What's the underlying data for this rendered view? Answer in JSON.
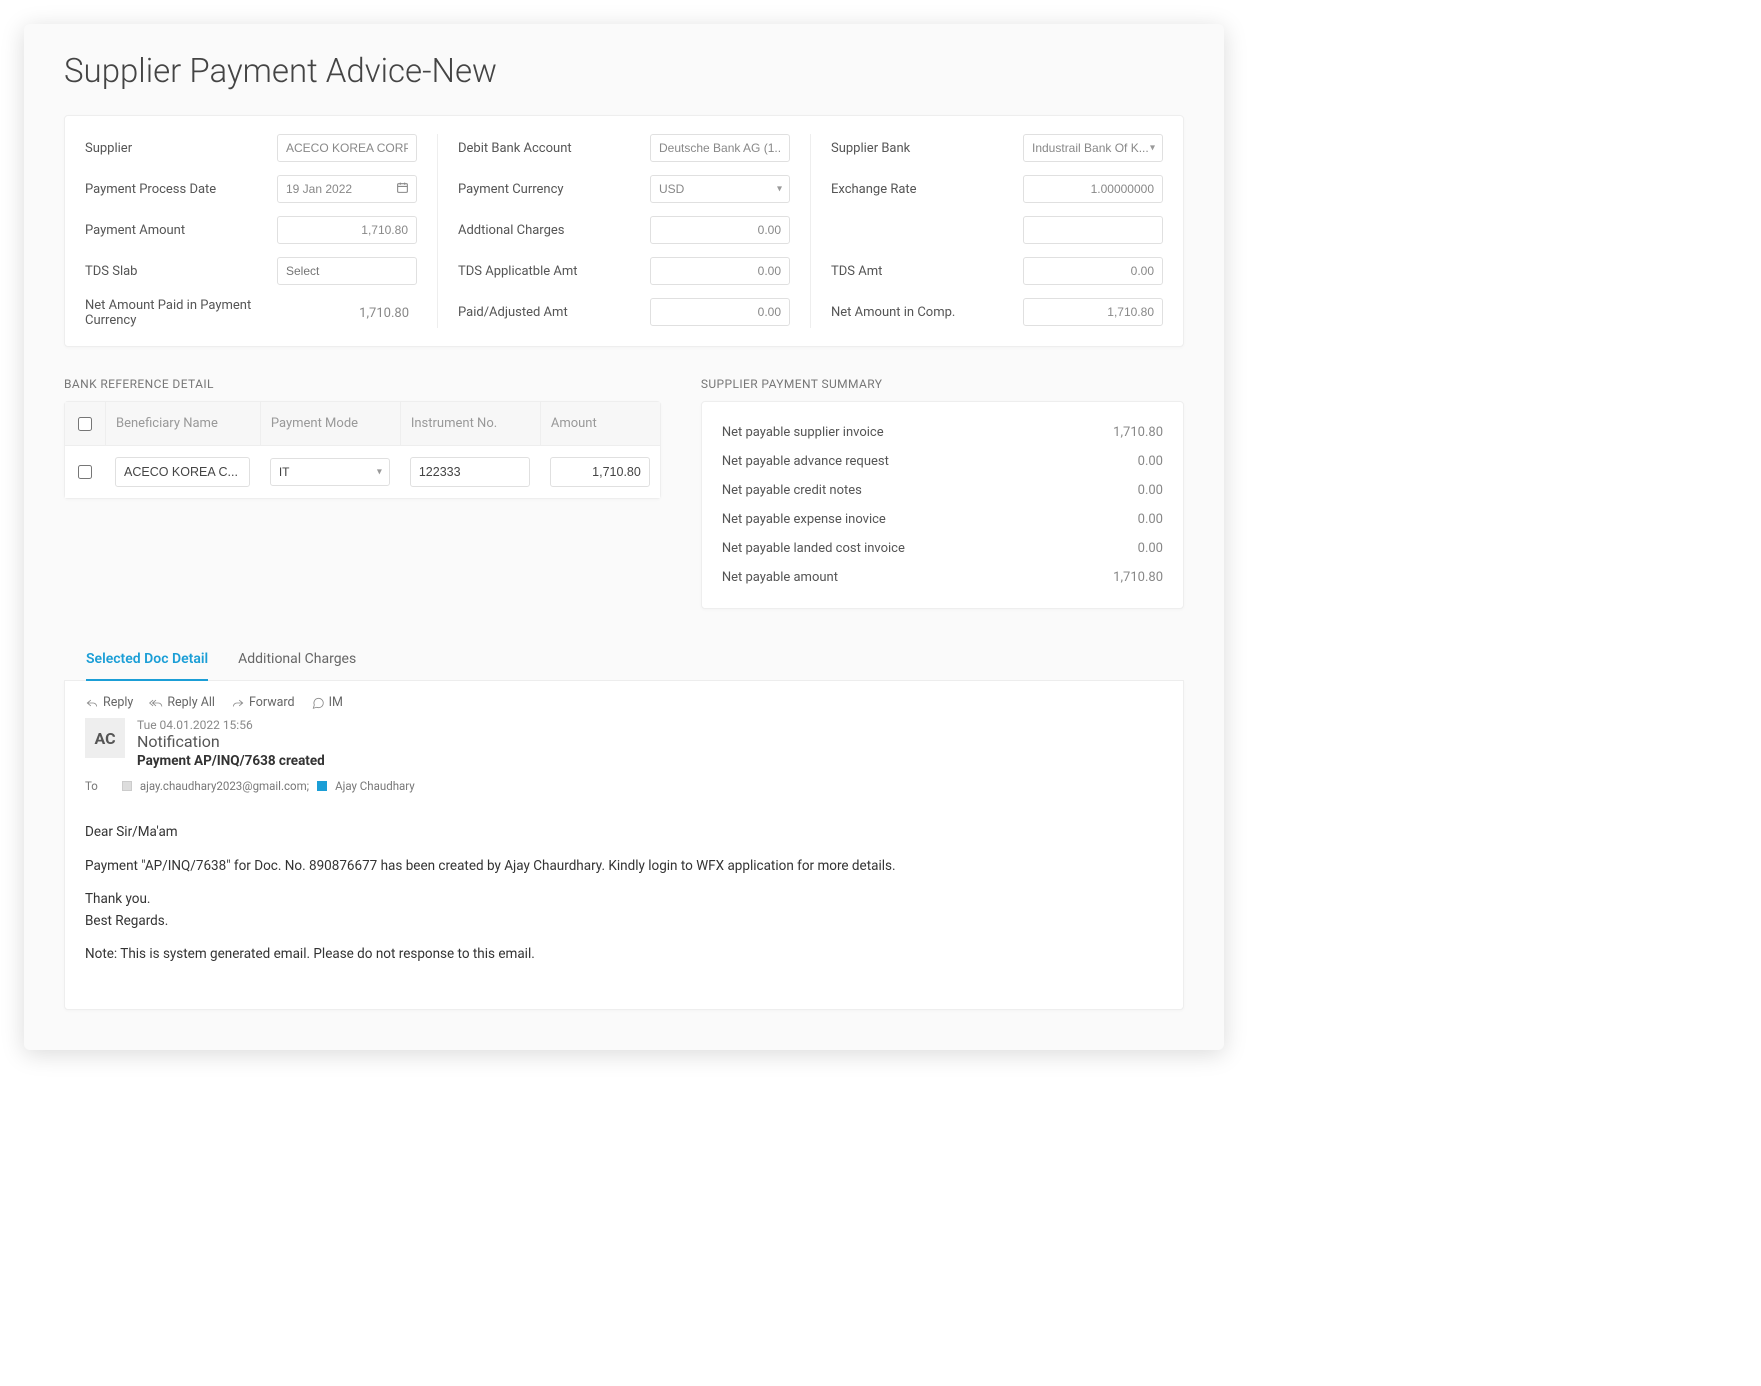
{
  "page_title": "Supplier Payment Advice-New",
  "form": {
    "col1": {
      "supplier_label": "Supplier",
      "supplier_value": "ACECO KOREA CORP",
      "process_date_label": "Payment Process Date",
      "process_date_value": "19 Jan 2022",
      "amount_label": "Payment Amount",
      "amount_value": "1,710.80",
      "tds_slab_label": "TDS Slab",
      "tds_slab_placeholder": "Select",
      "net_paid_label": "Net Amount Paid in Payment Currency",
      "net_paid_value": "1,710.80"
    },
    "col2": {
      "debit_bank_label": "Debit Bank Account",
      "debit_bank_value": "Deutsche Bank AG (1...",
      "currency_label": "Payment Currency",
      "currency_value": "USD",
      "addl_charges_label": "Addtional Charges",
      "addl_charges_value": "0.00",
      "tds_applicable_label": "TDS Applicatble Amt",
      "tds_applicable_value": "0.00",
      "paid_adj_label": "Paid/Adjusted Amt",
      "paid_adj_value": "0.00"
    },
    "col3": {
      "supplier_bank_label": "Supplier Bank",
      "supplier_bank_value": "Industrail Bank Of K...",
      "exchange_rate_label": "Exchange Rate",
      "exchange_rate_value": "1.00000000",
      "blank_value": "",
      "tds_amt_label": "TDS Amt",
      "tds_amt_value": "0.00",
      "net_comp_label": "Net Amount in Comp.",
      "net_comp_value": "1,710.80"
    }
  },
  "bank_ref": {
    "title": "BANK REFERENCE DETAIL",
    "headers": {
      "beneficiary": "Beneficiary Name",
      "mode": "Payment Mode",
      "instrument": "Instrument No.",
      "amount": "Amount"
    },
    "row": {
      "beneficiary": "ACECO KOREA C...",
      "mode": "IT",
      "instrument": "122333",
      "amount": "1,710.80"
    }
  },
  "summary": {
    "title": "SUPPLIER PAYMENT SUMMARY",
    "rows": {
      "invoice_label": "Net payable supplier invoice",
      "invoice_val": "1,710.80",
      "advance_label": "Net payable advance request",
      "advance_val": "0.00",
      "credit_label": "Net payable credit notes",
      "credit_val": "0.00",
      "expense_label": "Net payable expense inovice",
      "expense_val": "0.00",
      "landed_label": "Net payable landed cost invoice",
      "landed_val": "0.00",
      "amount_label": "Net payable amount",
      "amount_val": "1,710.80"
    }
  },
  "tabs": {
    "selected": "Selected Doc Detail",
    "additional": "Additional Charges"
  },
  "mail": {
    "actions": {
      "reply": "Reply",
      "reply_all": "Reply All",
      "forward": "Forward",
      "im": "IM"
    },
    "avatar": "AC",
    "timestamp": "Tue 04.01.2022  15:56",
    "from": "Notification",
    "subject": "Payment AP/INQ/7638 created",
    "to_label": "To",
    "to_email": "ajay.chaudhary2023@gmail.com;",
    "to_name": "Ajay Chaudhary",
    "body": {
      "greeting": "Dear Sir/Ma'am",
      "line1": "Payment \"AP/INQ/7638\" for Doc. No. 890876677 has been created by Ajay Chaurdhary. Kindly login to WFX application for more details.",
      "thanks": "Thank you.",
      "regards": "Best Regards.",
      "note": "Note: This is system generated email. Please do not response to this email."
    }
  }
}
